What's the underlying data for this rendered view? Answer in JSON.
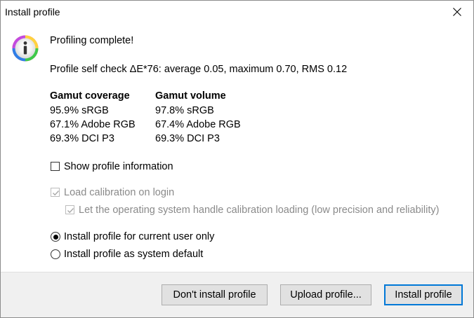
{
  "window": {
    "title": "Install profile"
  },
  "message": {
    "heading": "Profiling complete!",
    "self_check": "Profile self check ΔE*76: average 0.05, maximum 0.70, RMS 0.12"
  },
  "gamut": {
    "coverage_header": "Gamut coverage",
    "volume_header": "Gamut volume",
    "coverage": [
      "95.9% sRGB",
      "67.1% Adobe RGB",
      "69.3% DCI P3"
    ],
    "volume": [
      "97.8% sRGB",
      "67.4% Adobe RGB",
      "69.3% DCI P3"
    ]
  },
  "options": {
    "show_info": {
      "label": "Show profile information",
      "checked": false
    },
    "load_calibration": {
      "label": "Load calibration on login",
      "checked": true,
      "enabled": false
    },
    "os_handle": {
      "label": "Let the operating system handle calibration loading (low precision and reliability)",
      "checked": true,
      "enabled": false
    },
    "install_current_user": {
      "label": "Install profile for current user only",
      "selected": true
    },
    "install_system_default": {
      "label": "Install profile as system default",
      "selected": false
    }
  },
  "buttons": {
    "dont_install": "Don't install profile",
    "upload": "Upload profile...",
    "install": "Install profile"
  },
  "icons": {
    "close": "close-icon",
    "info": "info-icon"
  },
  "colors": {
    "accent": "#0078d7",
    "disabled_text": "#8a8a8a",
    "footer_bg": "#f0f0f0"
  }
}
